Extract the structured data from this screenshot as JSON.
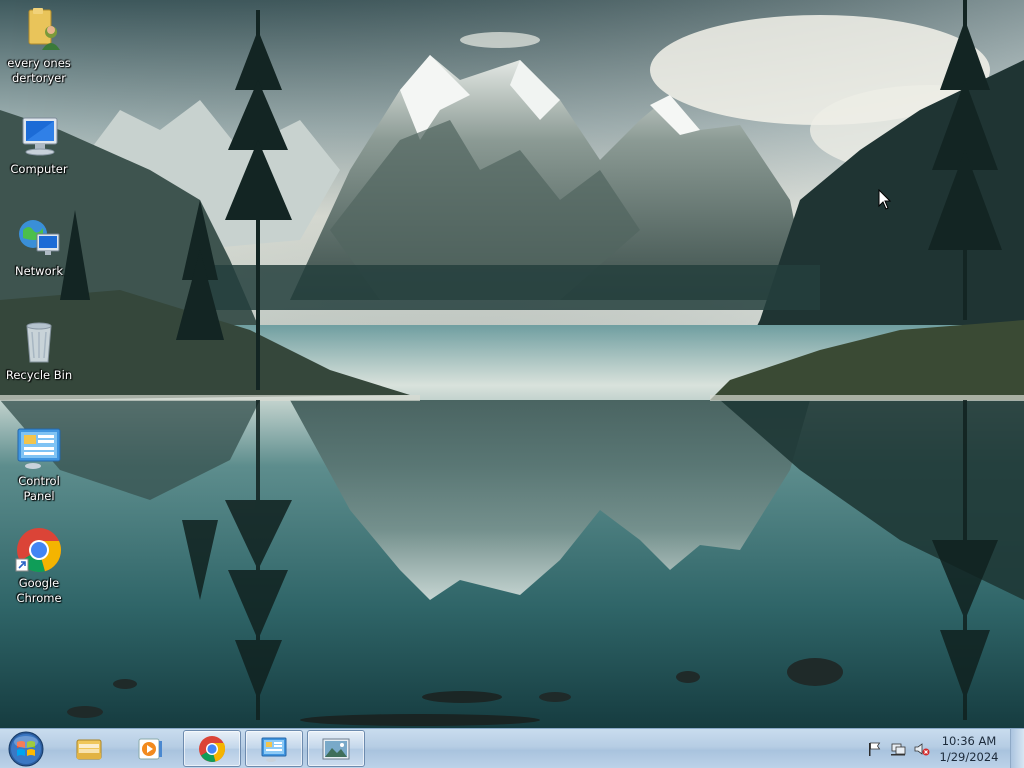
{
  "desktop": {
    "icons": [
      {
        "label": "every ones\ndertoryer",
        "icon": "user-folder-icon"
      },
      {
        "label": "Computer",
        "icon": "computer-icon"
      },
      {
        "label": "Network",
        "icon": "network-icon"
      },
      {
        "label": "Recycle Bin",
        "icon": "recycle-bin-icon"
      },
      {
        "label": "Control Panel",
        "icon": "control-panel-icon"
      },
      {
        "label": "Google\nChrome",
        "icon": "chrome-icon",
        "shortcut": true
      }
    ],
    "wallpaper": "mountain-lake-reflection"
  },
  "taskbar": {
    "start": "windows-orb-icon",
    "pinned": [
      {
        "icon": "windows-explorer-icon",
        "active": false
      },
      {
        "icon": "media-player-icon",
        "active": false
      },
      {
        "icon": "chrome-icon",
        "active": true
      },
      {
        "icon": "control-panel-icon",
        "active": true
      },
      {
        "icon": "picture-viewer-icon",
        "active": true
      }
    ],
    "tray": {
      "icons": [
        "action-center-flag-icon",
        "network-status-icon",
        "volume-muted-icon"
      ],
      "time": "10:36 AM",
      "date": "1/29/2024"
    }
  },
  "colors": {
    "taskbar_top": "#c9dcee",
    "taskbar_bottom": "#a9c3de",
    "sky": "#dde6e3",
    "lake": "#2f6b6f"
  }
}
